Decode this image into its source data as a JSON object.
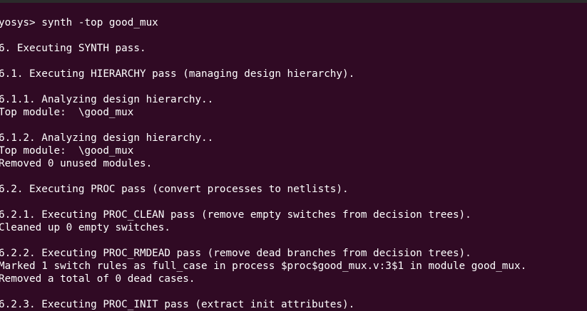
{
  "terminal": {
    "background": "#300a24",
    "foreground": "#ffffff",
    "lines": [
      "yosys> synth -top good_mux",
      "6. Executing SYNTH pass.",
      "6.1. Executing HIERARCHY pass (managing design hierarchy).",
      "6.1.1. Analyzing design hierarchy..",
      "Top module:  \\good_mux",
      "6.1.2. Analyzing design hierarchy..",
      "Top module:  \\good_mux",
      "Removed 0 unused modules.",
      "6.2. Executing PROC pass (convert processes to netlists).",
      "6.2.1. Executing PROC_CLEAN pass (remove empty switches from decision trees).",
      "Cleaned up 0 empty switches.",
      "6.2.2. Executing PROC_RMDEAD pass (remove dead branches from decision trees).",
      "Marked 1 switch rules as full_case in process $proc$good_mux.v:3$1 in module good_mux.",
      "Removed a total of 0 dead cases.",
      "6.2.3. Executing PROC_INIT pass (extract init attributes)."
    ]
  }
}
